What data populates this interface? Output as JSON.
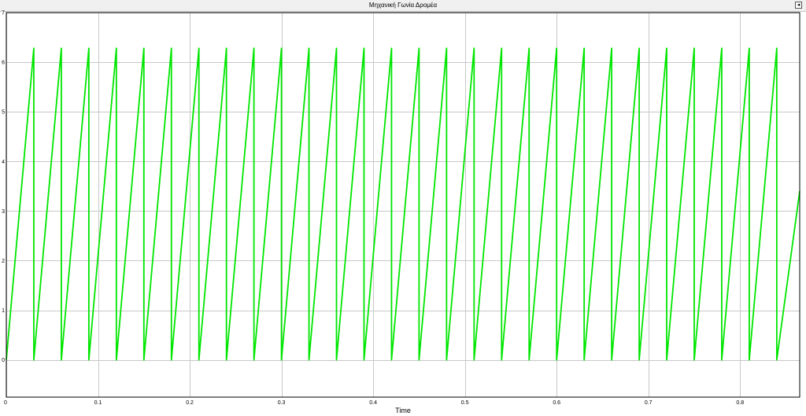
{
  "window": {
    "title": "Μηχανική Γωνία Δρομέα",
    "dock_icon": "dock-arrow-icon",
    "dock_glyph": "◂"
  },
  "chart_data": {
    "type": "line",
    "title": "Μηχανική Γωνία Δρομέα",
    "xlabel": "Time",
    "ylabel": "",
    "xlim": [
      0,
      0.865
    ],
    "ylim": [
      -0.75,
      7
    ],
    "xticks": [
      0,
      0.1,
      0.2,
      0.3,
      0.4,
      0.5,
      0.6,
      0.7,
      0.8
    ],
    "xtick_labels": [
      "0",
      "0.1",
      "0.2",
      "0.3",
      "0.4",
      "0.5",
      "0.6",
      "0.7",
      "0.8"
    ],
    "yticks": [
      0,
      1,
      2,
      3,
      4,
      5,
      6,
      7
    ],
    "ytick_labels": [
      "0",
      "1",
      "2",
      "3",
      "4",
      "5",
      "6",
      "7"
    ],
    "grid": true,
    "background_color": "#ffffff",
    "line_color": "#00e600",
    "series": [
      {
        "x": [
          0,
          0.03,
          0.03,
          0.06,
          0.06,
          0.09,
          0.09,
          0.12,
          0.12,
          0.15,
          0.15,
          0.18,
          0.18,
          0.21,
          0.21,
          0.24,
          0.24,
          0.27,
          0.27,
          0.3,
          0.3,
          0.33,
          0.33,
          0.36,
          0.36,
          0.39,
          0.39,
          0.42,
          0.42,
          0.45,
          0.45,
          0.48,
          0.48,
          0.51,
          0.51,
          0.54,
          0.54,
          0.57,
          0.57,
          0.6,
          0.6,
          0.63,
          0.63,
          0.66,
          0.66,
          0.69,
          0.69,
          0.72,
          0.72,
          0.75,
          0.75,
          0.78,
          0.78,
          0.81,
          0.81,
          0.84,
          0.84,
          0.865
        ],
        "y": [
          0,
          6.28,
          0,
          6.28,
          0,
          6.28,
          0,
          6.28,
          0,
          6.28,
          0,
          6.28,
          0,
          6.28,
          0,
          6.28,
          0,
          6.28,
          0,
          6.28,
          0,
          6.28,
          0,
          6.28,
          0,
          6.28,
          0,
          6.28,
          0,
          6.28,
          0,
          6.28,
          0,
          6.28,
          0,
          6.28,
          0,
          6.28,
          0,
          6.28,
          0,
          6.28,
          0,
          6.28,
          0,
          6.28,
          0,
          6.28,
          0,
          6.28,
          0,
          6.28,
          0,
          6.28,
          0,
          6.28,
          0,
          3.4
        ]
      }
    ]
  }
}
